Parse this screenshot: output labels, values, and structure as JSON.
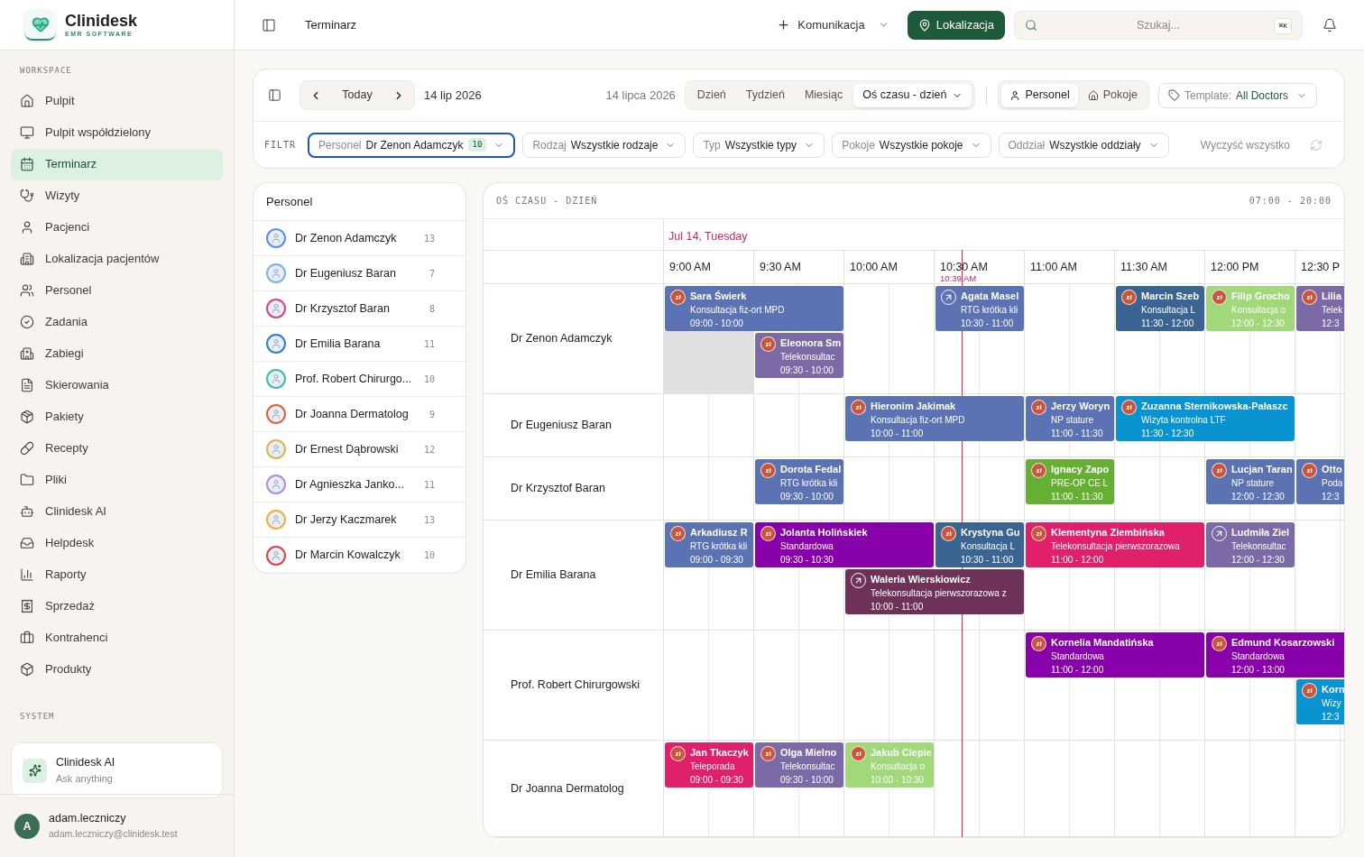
{
  "brand": {
    "name": "Clinidesk",
    "tagline": "EMR SOFTWARE"
  },
  "sidebar": {
    "sections": [
      {
        "title": "WORKSPACE",
        "items": [
          {
            "label": "Pulpit",
            "selected": false
          },
          {
            "label": "Pulpit współdzielony",
            "selected": false
          },
          {
            "label": "Terminarz",
            "selected": true
          },
          {
            "label": "Wizyty",
            "selected": false
          },
          {
            "label": "Pacjenci",
            "selected": false
          },
          {
            "label": "Lokalizacja pacjentów",
            "selected": false
          },
          {
            "label": "Personel",
            "selected": false
          },
          {
            "label": "Zadania",
            "selected": false
          },
          {
            "label": "Zabiegi",
            "selected": false
          },
          {
            "label": "Skierowania",
            "selected": false
          },
          {
            "label": "Pakiety",
            "selected": false
          },
          {
            "label": "Recepty",
            "selected": false
          },
          {
            "label": "Pliki",
            "selected": false
          },
          {
            "label": "Clinidesk AI",
            "selected": false
          },
          {
            "label": "Helpdesk",
            "selected": false
          },
          {
            "label": "Raporty",
            "selected": false
          },
          {
            "label": "Sprzedaż",
            "selected": false
          },
          {
            "label": "Kontrahenci",
            "selected": false
          },
          {
            "label": "Produkty",
            "selected": false
          }
        ]
      },
      {
        "title": "SYSTEM"
      }
    ],
    "assistant": {
      "title": "Clinidesk AI",
      "subtitle": "Ask anything"
    },
    "user": {
      "initial": "A",
      "name": "adam.leczniczy",
      "email": "adam.leczniczy@clinidesk.test"
    }
  },
  "header": {
    "title": "Terminarz",
    "communication": "Komunikacja",
    "location": "Lokalizacja",
    "search_placeholder": "Szukaj...",
    "shortcut": "⌘K"
  },
  "toolbar": {
    "today": "Today",
    "date": "14 lip 2026",
    "date_long": "14 lipca 2026",
    "views": [
      {
        "label": "Dzień",
        "selected": false
      },
      {
        "label": "Tydzień",
        "selected": false
      },
      {
        "label": "Miesiąc",
        "selected": false
      },
      {
        "label": "Oś czasu - dzień",
        "selected": true
      }
    ],
    "modes": [
      {
        "label": "Personel",
        "selected": true
      },
      {
        "label": "Pokoje",
        "selected": false
      }
    ],
    "template": {
      "label": "Template:",
      "value": "All Doctors"
    }
  },
  "filters": {
    "label": "FILTR",
    "chips": [
      {
        "label": "Personel",
        "value": "Dr Zenon Adamczyk",
        "count": "10",
        "active": true
      },
      {
        "label": "Rodzaj",
        "value": "Wszystkie rodzaje",
        "active": false
      },
      {
        "label": "Typ",
        "value": "Wszystkie typy",
        "active": false
      },
      {
        "label": "Pokoje",
        "value": "Wszystkie pokoje",
        "active": false
      },
      {
        "label": "Oddział",
        "value": "Wszystkie oddziały",
        "active": false
      }
    ],
    "clear": "Wyczyść wszystko"
  },
  "staff_panel": {
    "title": "Personel",
    "items": [
      {
        "name": "Dr Zenon Adamczyk",
        "count": "13",
        "color": "#5b8def"
      },
      {
        "name": "Dr Eugeniusz Baran",
        "count": "7",
        "color": "#7ab2e0"
      },
      {
        "name": "Dr Krzysztof Baran",
        "count": "8",
        "color": "#e0407a"
      },
      {
        "name": "Dr Emilia Barana",
        "count": "11",
        "color": "#2e7dd6"
      },
      {
        "name": "Prof. Robert Chirurgo...",
        "count": "10",
        "color": "#3bbfa0"
      },
      {
        "name": "Dr Joanna Dermatolog",
        "count": "9",
        "color": "#e0603a"
      },
      {
        "name": "Dr Ernest Dąbrowski",
        "count": "12",
        "color": "#e8b040"
      },
      {
        "name": "Dr Agnieszka Janko...",
        "count": "11",
        "color": "#b08ae0"
      },
      {
        "name": "Dr Jerzy Kaczmarek",
        "count": "13",
        "color": "#f0b030"
      },
      {
        "name": "Dr Marcin Kowalczyk",
        "count": "10",
        "color": "#e04040"
      }
    ]
  },
  "timeline": {
    "title": "OŚ CZASU - DZIEŃ",
    "range": "07:00 - 20:00",
    "date": "Jul 14, Tuesday",
    "now_label": "10:39 AM",
    "times": [
      "9:00 AM",
      "9:30 AM",
      "10:00 AM",
      "10:30 AM",
      "11:00 AM",
      "11:30 AM",
      "12:00 PM",
      "12:30 P"
    ],
    "rows": [
      {
        "name": "Dr Zenon Adamczyk",
        "blocked_slot": true,
        "events": [
          {
            "kind": "paid",
            "badge": "zł",
            "patient": "Sara Świerk",
            "type": "Konsultacja fiz-ort MPD",
            "time": "09:00 - 10:00",
            "color": "#5b73b3"
          },
          {
            "kind": "transfer",
            "patient": "Agata Masel",
            "type": "RTG krótka kli",
            "time": "10:30 - 11:00",
            "color": "#5b73b3"
          },
          {
            "kind": "paid",
            "badge": "zł",
            "patient": "Marcin Szeb",
            "type": "Konsultacja L",
            "time": "11:30 - 12:00",
            "color": "#3a6592"
          },
          {
            "kind": "paid",
            "badge": "zł",
            "patient": "Filip Grocho",
            "type": "Konsultacja o",
            "time": "12:00 - 12:30",
            "color": "#a0d87a"
          },
          {
            "kind": "paid",
            "badge": "zł",
            "patient": "Lilia",
            "type": "Telek",
            "time": "12:3",
            "color": "#7c6aa6"
          },
          {
            "kind": "paid",
            "badge": "zł",
            "patient": "Eleonora Sm",
            "type": "Telekonsultac",
            "time": "09:30 - 10:00",
            "color": "#7c6aa6"
          }
        ]
      },
      {
        "name": "Dr Eugeniusz Baran",
        "blocked_slot": false,
        "events": [
          {
            "kind": "paid",
            "badge": "zł",
            "patient": "Hieronim Jakimak",
            "type": "Konsultacja fiz-ort MPD",
            "time": "10:00 - 11:00",
            "color": "#5b73b3"
          },
          {
            "kind": "paid",
            "badge": "zł",
            "patient": "Jerzy Woryn",
            "type": "NP stature",
            "time": "11:00 - 11:30",
            "color": "#5b73b3"
          },
          {
            "kind": "paid",
            "badge": "zł",
            "patient": "Zuzanna Sternikowska-Pałaszc",
            "type": "Wizyta kontrolna LTF",
            "time": "11:30 - 12:30",
            "color": "#0a93d1"
          }
        ]
      },
      {
        "name": "Dr Krzysztof Baran",
        "blocked_slot": false,
        "events": [
          {
            "kind": "paid",
            "badge": "zł",
            "patient": "Dorota Fedal",
            "type": "RTG krótka kli",
            "time": "09:30 - 10:00",
            "color": "#5b73b3"
          },
          {
            "kind": "paid",
            "badge": "zł",
            "patient": "Ignacy Zapo",
            "type": "PRE-OP CE L",
            "time": "11:00 - 11:30",
            "color": "#65b032"
          },
          {
            "kind": "paid",
            "badge": "zł",
            "patient": "Lucjan Taran",
            "type": "NP stature",
            "time": "12:00 - 12:30",
            "color": "#5b73b3"
          },
          {
            "kind": "paid",
            "badge": "zł",
            "patient": "Otto",
            "type": "Poda",
            "time": "12:3",
            "color": "#5b73b3"
          }
        ]
      },
      {
        "name": "Dr Emilia Barana",
        "blocked_slot": false,
        "events": [
          {
            "kind": "paid",
            "badge": "zł",
            "patient": "Arkadiusz R",
            "type": "RTG krótka kli",
            "time": "09:00 - 09:30",
            "color": "#5b73b3"
          },
          {
            "kind": "paid",
            "badge": "zł",
            "patient": "Jolanta Holińskiek",
            "type": "Standardowa",
            "time": "09:30 - 10:30",
            "color": "#8800aa"
          },
          {
            "kind": "paid",
            "badge": "zł",
            "patient": "Krystyna Gu",
            "type": "Konsultacja L",
            "time": "10:30 - 11:00",
            "color": "#3a6592"
          },
          {
            "kind": "paid",
            "badge": "zł",
            "patient": "Klementyna Ziembińska",
            "type": "Telekonsultacja pierwszorazowa",
            "time": "11:00 - 12:00",
            "color": "#e0206a"
          },
          {
            "kind": "transfer",
            "patient": "Ludmiła Ziel",
            "type": "Telekonsultac",
            "time": "12:00 - 12:30",
            "color": "#7c6aa6"
          },
          {
            "kind": "transfer",
            "patient": "Waleria Wierskiowicz",
            "type": "Telekonsultacja pierwszorazowa z",
            "time": "10:00 - 11:00",
            "color": "#6e3157"
          }
        ]
      },
      {
        "name": "Prof. Robert Chirurgowski",
        "blocked_slot": false,
        "events": [
          {
            "kind": "paid",
            "badge": "zł",
            "patient": "Kornelia Mandatińska",
            "type": "Standardowa",
            "time": "11:00 - 12:00",
            "color": "#8800aa"
          },
          {
            "kind": "paid",
            "badge": "zł",
            "patient": "Edmund Kosarzowski",
            "type": "Standardowa",
            "time": "12:00 - 13:00",
            "color": "#8800aa"
          },
          {
            "kind": "paid",
            "badge": "zł",
            "patient": "Korn",
            "type": "Wizy",
            "time": "12:3",
            "color": "#0a93d1"
          }
        ]
      },
      {
        "name": "Dr Joanna Dermatolog",
        "blocked_slot": false,
        "events": [
          {
            "kind": "paid",
            "badge": "zł",
            "patient": "Jan Tkaczyk",
            "type": "Teleporada",
            "time": "09:00 - 09:30",
            "color": "#e0206a"
          },
          {
            "kind": "paid",
            "badge": "zł",
            "patient": "Olga Mielno",
            "type": "Telekonsultac",
            "time": "09:30 - 10:00",
            "color": "#7c6aa6"
          },
          {
            "kind": "paid",
            "badge": "zł",
            "patient": "Jakub Ciepie",
            "type": "Konsultacja o",
            "time": "10:00 - 10:30",
            "color": "#a0d87a"
          }
        ]
      }
    ]
  }
}
